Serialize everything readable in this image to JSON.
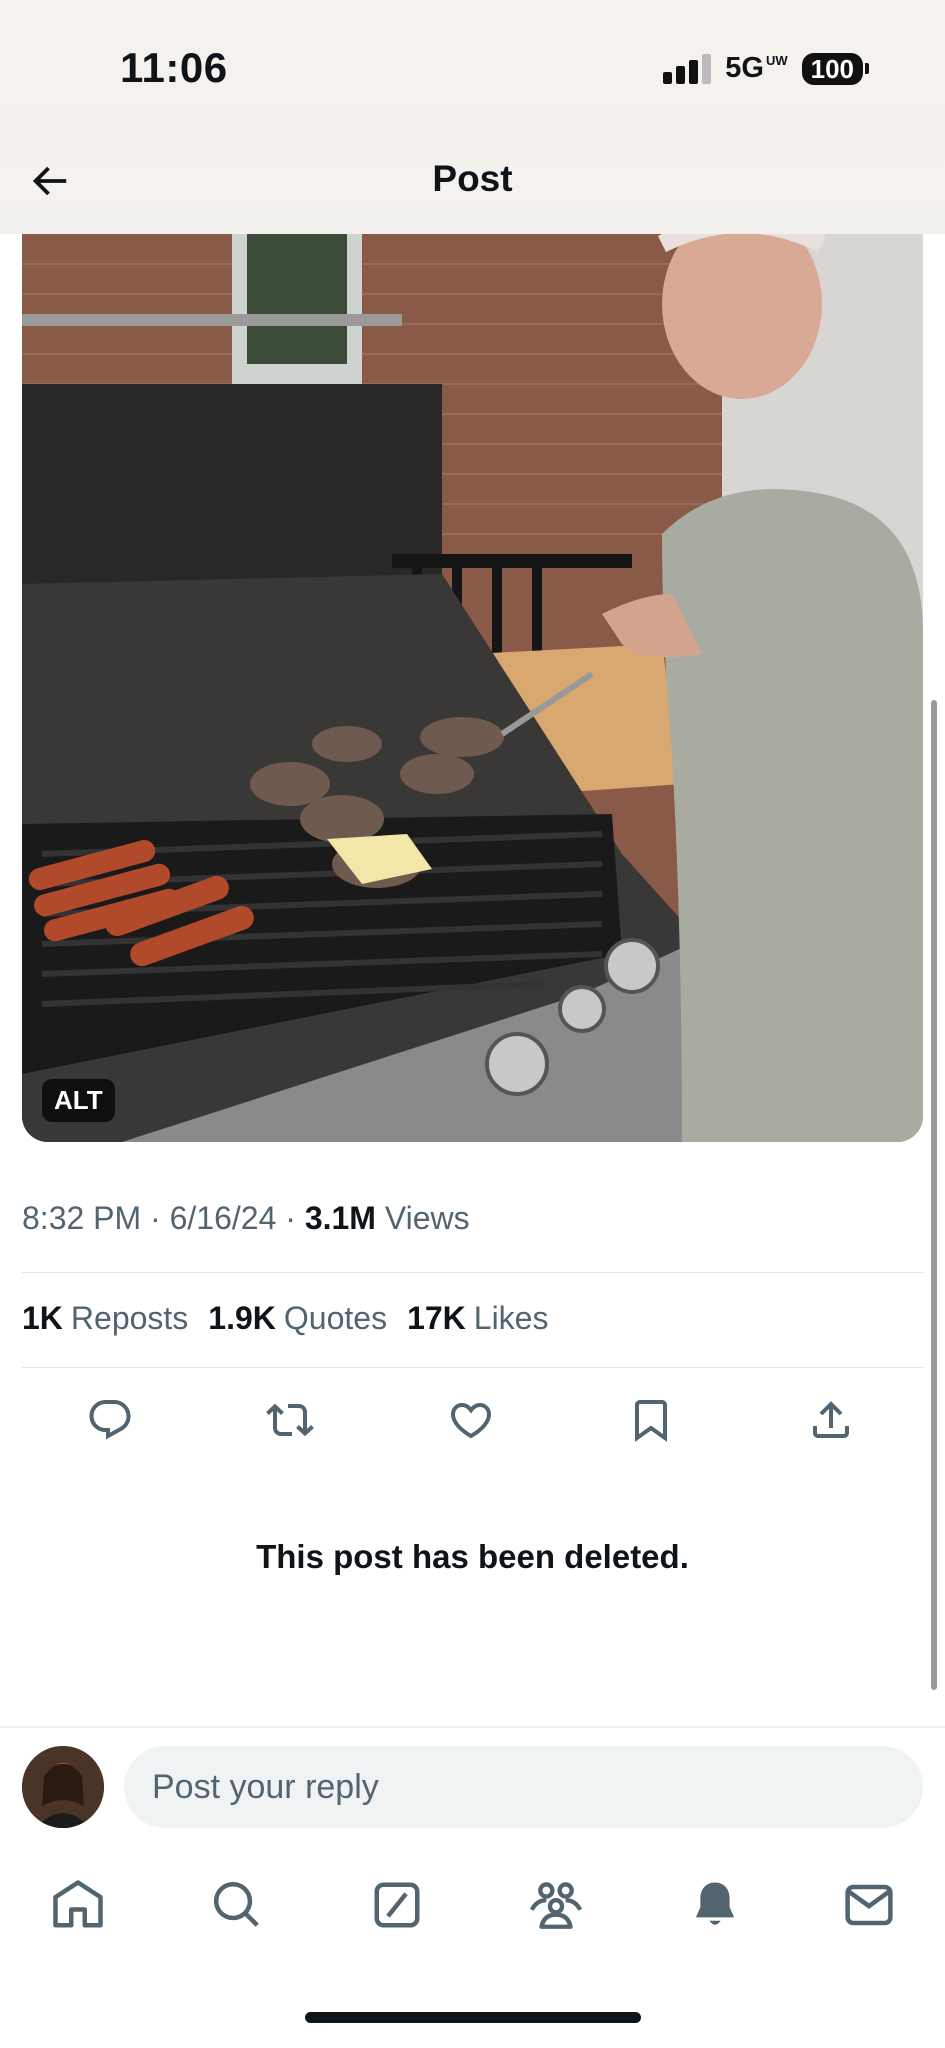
{
  "status_bar": {
    "time": "11:06",
    "network": "5G",
    "network_sub": "UW",
    "battery": "100"
  },
  "header": {
    "title": "Post",
    "back_icon": "arrow-left-icon"
  },
  "media": {
    "alt_badge": "ALT"
  },
  "post_meta": {
    "time": "8:32 PM",
    "date": "6/16/24",
    "views_count": "3.1M",
    "views_label": "Views"
  },
  "stats": [
    {
      "count": "1K",
      "label": "Reposts"
    },
    {
      "count": "1.9K",
      "label": "Quotes"
    },
    {
      "count": "17K",
      "label": "Likes"
    }
  ],
  "actions": [
    "reply-icon",
    "repost-icon",
    "like-icon",
    "bookmark-icon",
    "share-icon"
  ],
  "deleted_notice": "This post has been deleted.",
  "reply": {
    "placeholder": "Post your reply"
  },
  "tabs": [
    "home-icon",
    "search-icon",
    "grok-icon",
    "communities-icon",
    "notifications-icon",
    "messages-icon"
  ],
  "colors": {
    "text": "#0f1419",
    "secondary": "#536471",
    "input_bg": "#eff3f4"
  }
}
